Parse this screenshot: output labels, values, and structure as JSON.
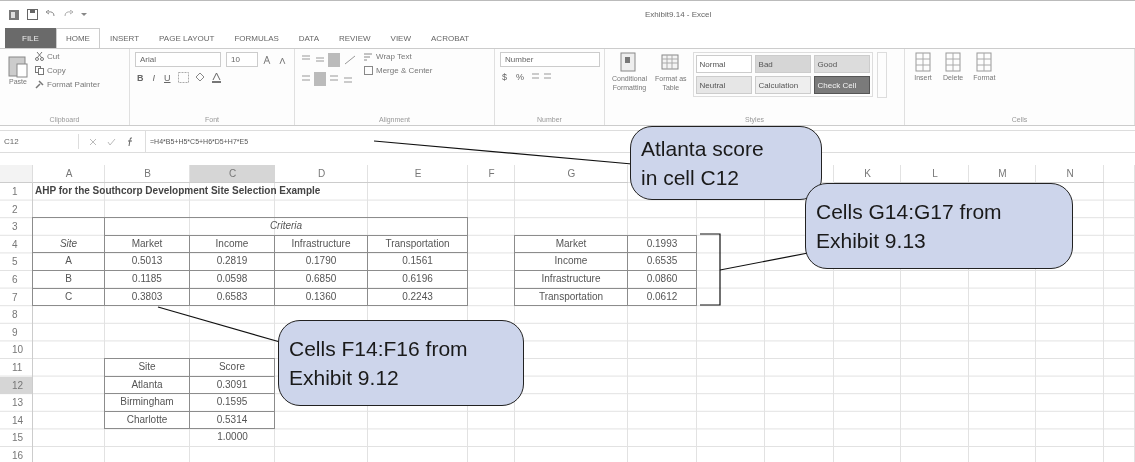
{
  "window": {
    "title": "Exhibit9.14 - Excel"
  },
  "tabs": [
    {
      "label": "FILE",
      "kind": "file",
      "selected": false
    },
    {
      "label": "HOME",
      "kind": "tab",
      "selected": true
    },
    {
      "label": "INSERT",
      "kind": "tab",
      "selected": false
    },
    {
      "label": "PAGE LAYOUT",
      "kind": "tab",
      "selected": false
    },
    {
      "label": "FORMULAS",
      "kind": "tab",
      "selected": false
    },
    {
      "label": "DATA",
      "kind": "tab",
      "selected": false
    },
    {
      "label": "REVIEW",
      "kind": "tab",
      "selected": false
    },
    {
      "label": "VIEW",
      "kind": "tab",
      "selected": false
    },
    {
      "label": "ACROBAT",
      "kind": "tab",
      "selected": false
    }
  ],
  "ribbon": {
    "clipboard": {
      "paste": "Paste",
      "cut": "Cut",
      "copy": "Copy",
      "format_painter": "Format Painter",
      "label": "Clipboard"
    },
    "font": {
      "name": "Arial",
      "size": "10",
      "format_buttons": [
        "B",
        "I",
        "U"
      ],
      "label": "Font"
    },
    "alignment": {
      "wrap_text": "Wrap Text",
      "merge": "Merge & Center",
      "label": "Alignment"
    },
    "number": {
      "format": "Number",
      "currency": "$",
      "percent": "%",
      "label": "Number"
    },
    "styles": {
      "conditional": [
        "Conditional",
        "Formatting"
      ],
      "format_table": [
        "Format as",
        "Table"
      ],
      "gallery": [
        {
          "label": "Normal",
          "color": "#ffffff"
        },
        {
          "label": "Bad",
          "color": "#d6d6d6"
        },
        {
          "label": "Good",
          "color": "#dcdcdc"
        },
        {
          "label": "Neutral",
          "color": "#e6e6e6"
        },
        {
          "label": "Calculation",
          "color": "#eeeeee"
        },
        {
          "label": "Check Cell",
          "color": "#7a7a7a"
        }
      ],
      "label": "Styles"
    },
    "cells": {
      "buttons": [
        "Insert",
        "Delete",
        "Format"
      ],
      "label": "Cells"
    }
  },
  "formula_bar": {
    "name_box": "C12",
    "formula": "=H4*B5+H5*C5+H6*D5+H7*E5"
  },
  "sheet": {
    "column_headers": [
      {
        "label": "A",
        "selected": false
      },
      {
        "label": "B",
        "selected": false
      },
      {
        "label": "C",
        "selected": true
      },
      {
        "label": "D",
        "selected": false
      },
      {
        "label": "E",
        "selected": false
      },
      {
        "label": "F",
        "selected": false
      },
      {
        "label": "G",
        "selected": false
      },
      {
        "label": "K",
        "selected": false
      },
      {
        "label": "L",
        "selected": false
      },
      {
        "label": "M",
        "selected": false
      },
      {
        "label": "N",
        "selected": false
      }
    ],
    "rows": [
      {
        "number": "1",
        "selected": false
      },
      {
        "number": "2",
        "selected": false
      },
      {
        "number": "3",
        "selected": false
      },
      {
        "number": "4",
        "selected": false
      },
      {
        "number": "5",
        "selected": false
      },
      {
        "number": "6",
        "selected": false
      },
      {
        "number": "7",
        "selected": false
      },
      {
        "number": "8",
        "selected": false
      },
      {
        "number": "9",
        "selected": false
      },
      {
        "number": "10",
        "selected": false
      },
      {
        "number": "11",
        "selected": false
      },
      {
        "number": "12",
        "selected": true
      },
      {
        "number": "13",
        "selected": false
      },
      {
        "number": "14",
        "selected": false
      },
      {
        "number": "15",
        "selected": false
      },
      {
        "number": "16",
        "selected": false
      }
    ],
    "title": "AHP for the Southcorp Development Site Selection Example",
    "criteria_table": {
      "site_header": "Site",
      "group_header": "Criteria",
      "columns": [
        "Market",
        "Income",
        "Infrastructure",
        "Transportation"
      ],
      "rows": [
        {
          "site": "A",
          "values": [
            "0.5013",
            "0.2819",
            "0.1790",
            "0.1561"
          ]
        },
        {
          "site": "B",
          "values": [
            "0.1185",
            "0.0598",
            "0.6850",
            "0.6196"
          ]
        },
        {
          "site": "C",
          "values": [
            "0.3803",
            "0.6583",
            "0.1360",
            "0.2243"
          ]
        }
      ]
    },
    "weights_table": [
      {
        "criterion": "Market",
        "weight": "0.1993"
      },
      {
        "criterion": "Income",
        "weight": "0.6535"
      },
      {
        "criterion": "Infrastructure",
        "weight": "0.0860"
      },
      {
        "criterion": "Transportation",
        "weight": "0.0612"
      }
    ],
    "score_table": {
      "columns": [
        "Site",
        "Score"
      ],
      "rows": [
        {
          "site": "Atlanta",
          "score": "0.3091"
        },
        {
          "site": "Birmingham",
          "score": "0.1595"
        },
        {
          "site": "Charlotte",
          "score": "0.5314"
        }
      ],
      "total": "1.0000"
    }
  },
  "callouts": [
    {
      "kind": "formula",
      "lines": [
        "Atlanta score",
        "in cell C12"
      ]
    },
    {
      "kind": "weights",
      "lines": [
        "Cells G14:G17 from",
        "Exhibit 9.13"
      ]
    },
    {
      "kind": "scores",
      "lines": [
        "Cells F14:F16 from",
        "Exhibit 9.12"
      ]
    }
  ]
}
